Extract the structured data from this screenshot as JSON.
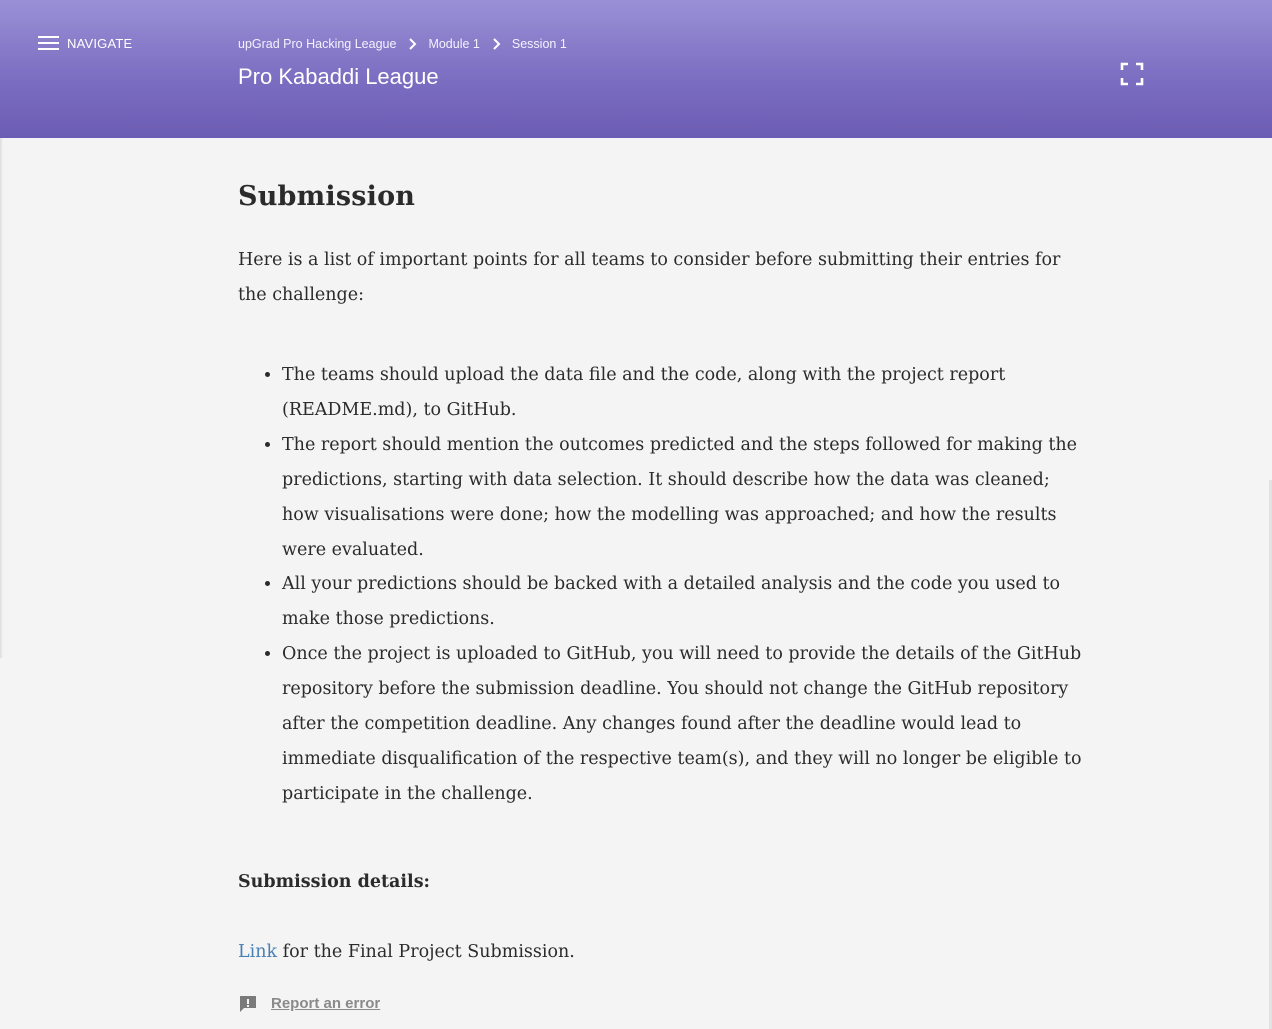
{
  "header": {
    "nav_label": "NAVIGATE",
    "breadcrumb": [
      "upGrad Pro Hacking League",
      "Module 1",
      "Session 1"
    ],
    "title": "Pro Kabaddi League",
    "gradient_top": "#9a90d6",
    "gradient_bottom": "#6c5db4",
    "icons": {
      "nav": "hamburger-icon",
      "separator": "chevron-right-icon",
      "fullscreen": "fullscreen-icon"
    }
  },
  "content": {
    "heading": "Submission",
    "intro": "Here is a list of important points for all teams to consider before submitting their entries for the challenge:",
    "points": [
      "The teams should upload the data file and the code, along with the project report (README.md), to GitHub.",
      "The report should mention the outcomes predicted and the steps followed for making the predictions, starting with data selection. It should describe how the data was cleaned; how visualisations were done; how the modelling was approached; and how the results were evaluated.",
      "All your predictions should be backed with a detailed analysis and the code you used to make those predictions.",
      "Once the project is uploaded to GitHub, you will need to provide the details of the GitHub repository before the submission deadline. You should not change the GitHub repository after the competition deadline. Any changes found after the deadline would lead to immediate disqualification of the respective team(s), and they will no longer be eligible to participate in the challenge."
    ],
    "details_label": "Submission details:",
    "link_text": "Link",
    "link_suffix": " for the Final Project Submission.",
    "link_color": "#4a7fb5",
    "report_label": "Report an error",
    "report_icon": "feedback-icon"
  }
}
